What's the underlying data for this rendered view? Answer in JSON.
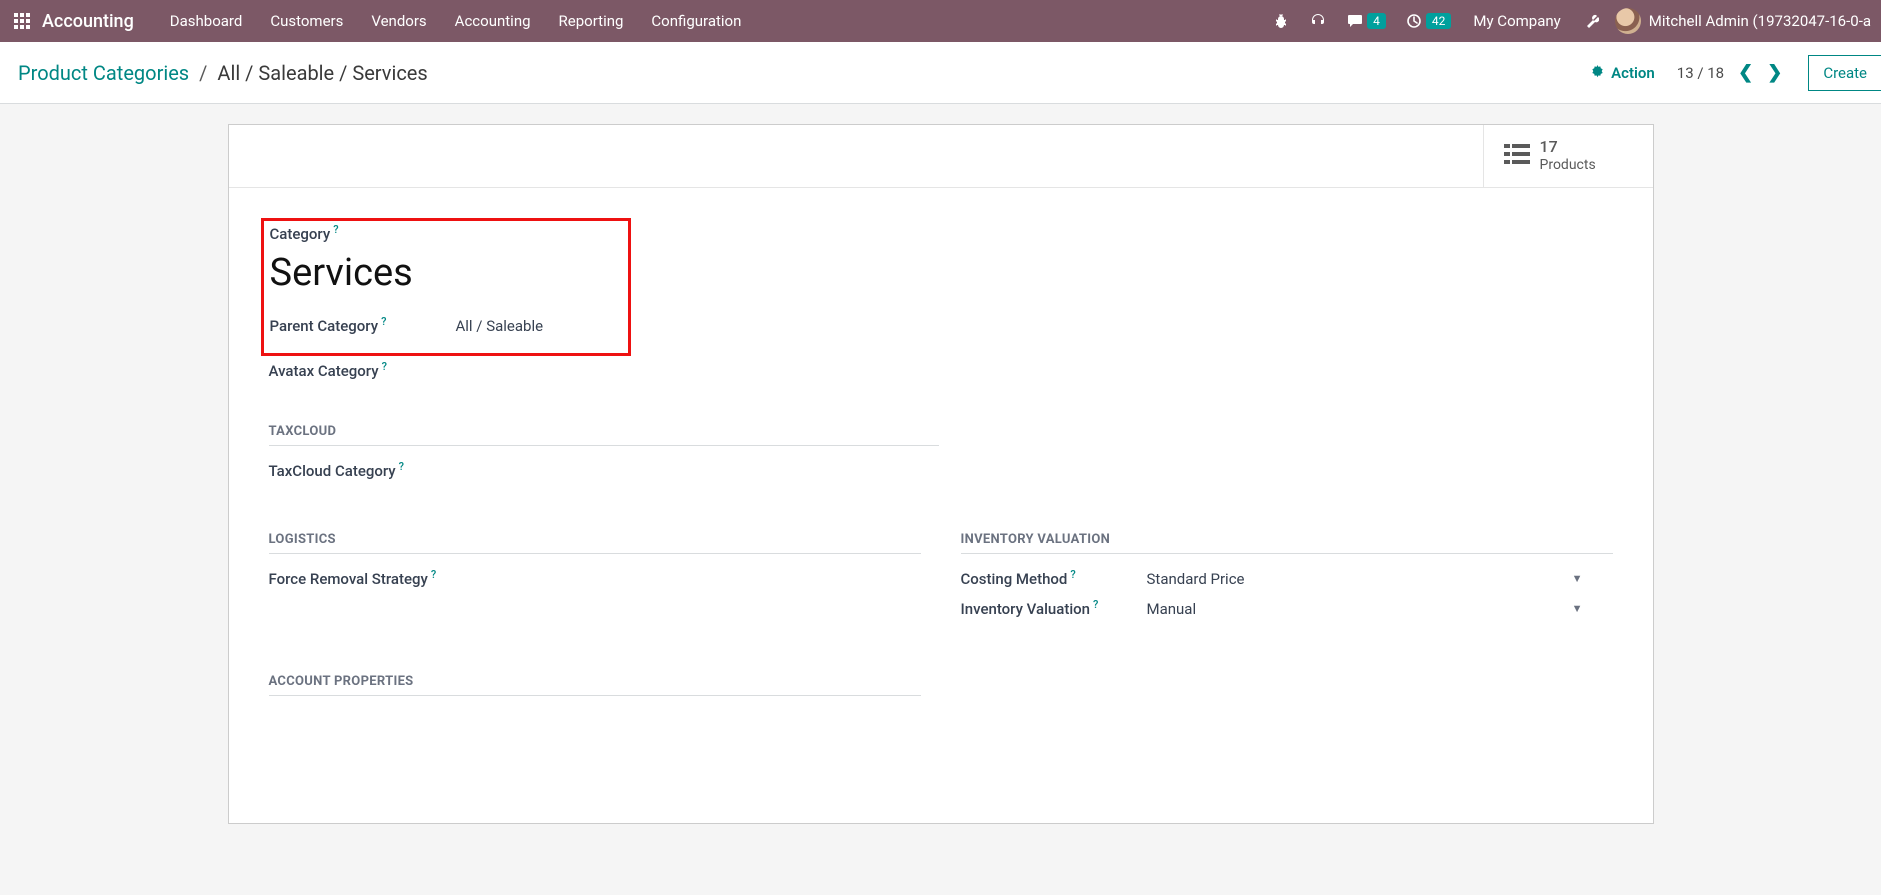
{
  "topbar": {
    "brand": "Accounting",
    "nav": [
      "Dashboard",
      "Customers",
      "Vendors",
      "Accounting",
      "Reporting",
      "Configuration"
    ],
    "chat_badge": "4",
    "clock_badge": "42",
    "company": "My Company",
    "user": "Mitchell Admin (19732047-16-0-a"
  },
  "breadcrumb": {
    "root": "Product Categories",
    "path": "All / Saleable / Services"
  },
  "actions": {
    "action_label": "Action",
    "pager": "13 / 18",
    "create": "Create"
  },
  "stat": {
    "count": "17",
    "label": "Products"
  },
  "form": {
    "category_label": "Category",
    "category_value": "Services",
    "parent_label": "Parent Category",
    "parent_value": "All / Saleable",
    "avatax_label": "Avatax Category",
    "section_taxcloud": "TAXCLOUD",
    "taxcloud_label": "TaxCloud Category",
    "section_logistics": "LOGISTICS",
    "removal_label": "Force Removal Strategy",
    "section_inventory": "INVENTORY VALUATION",
    "costing_label": "Costing Method",
    "costing_value": "Standard Price",
    "invval_label": "Inventory Valuation",
    "invval_value": "Manual",
    "section_account": "ACCOUNT PROPERTIES"
  }
}
